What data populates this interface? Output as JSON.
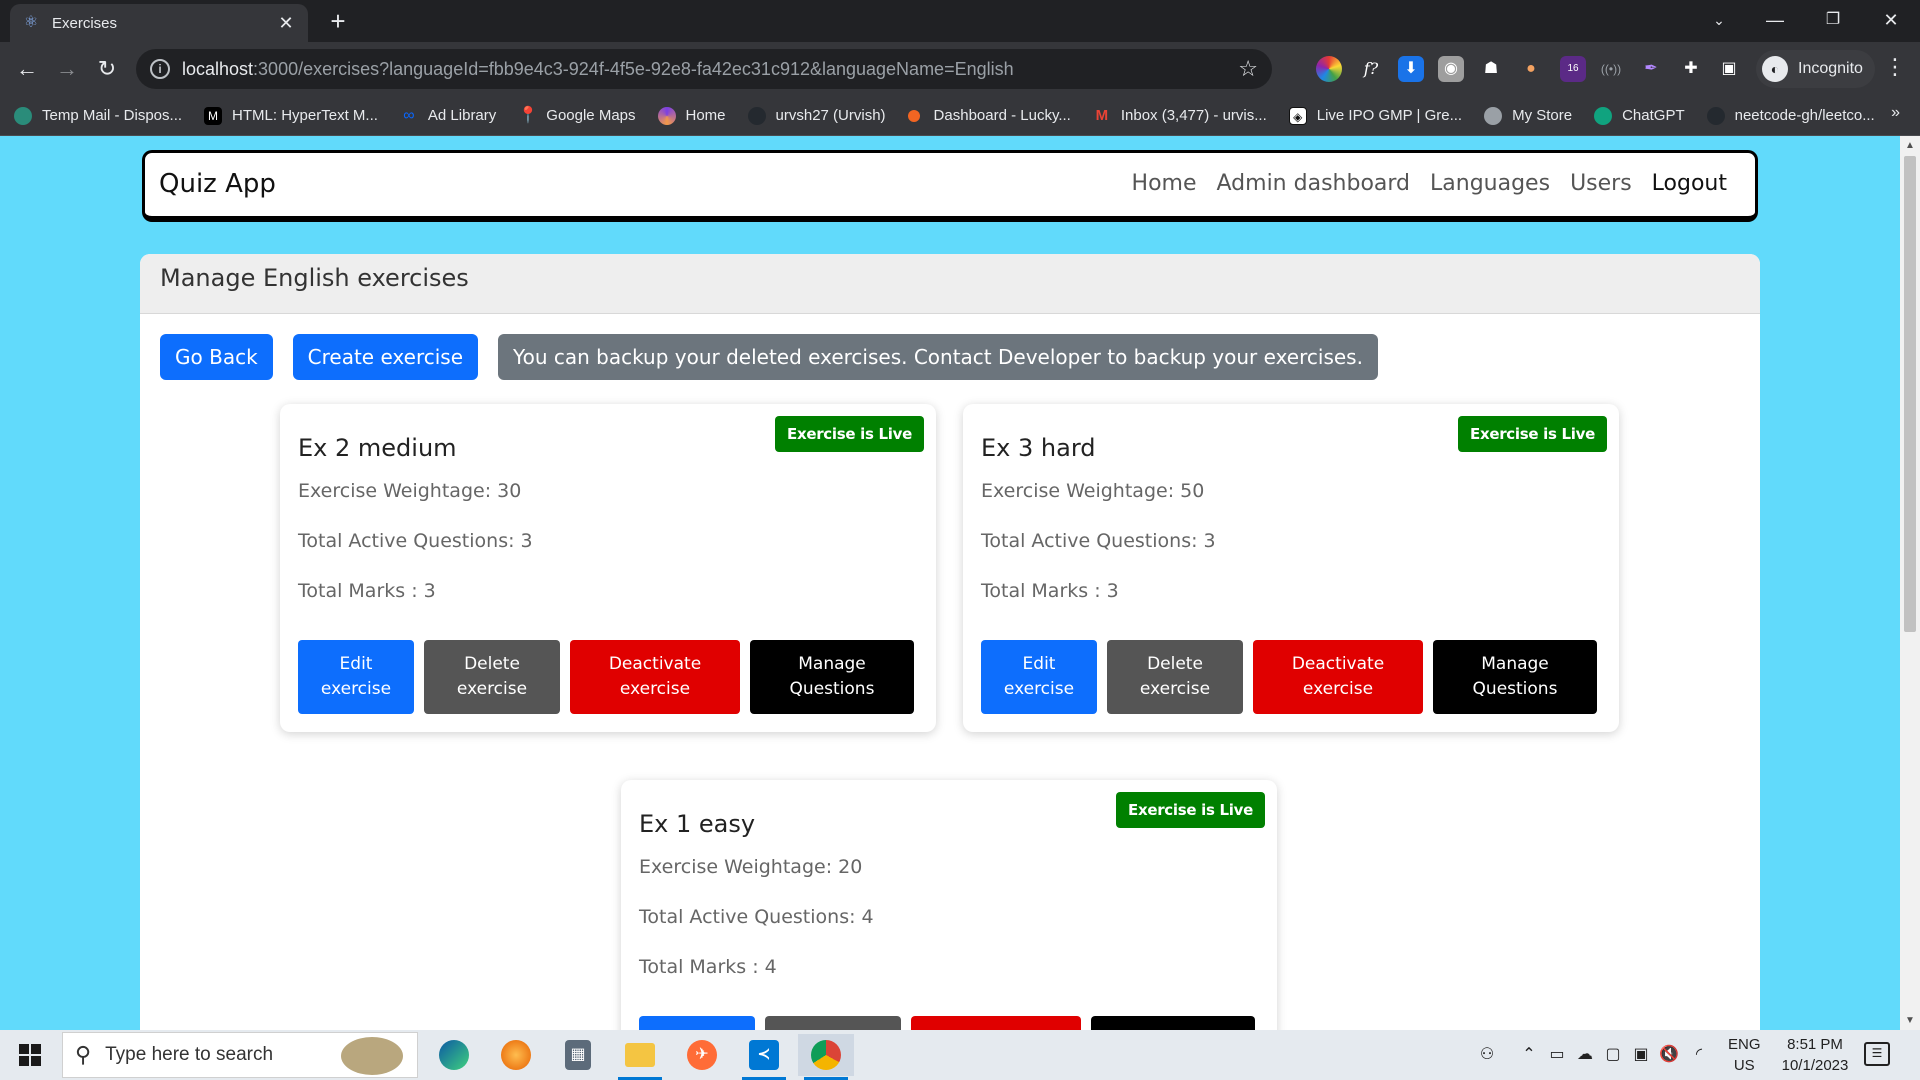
{
  "browser": {
    "tab_title": "Exercises",
    "url_host": "localhost",
    "url_rest": ":3000/exercises?languageId=fbb9e4c3-924f-4f5e-92e8-fa42ec31c912&languageName=English",
    "incognito_label": "Incognito",
    "extension_badge": "16",
    "bookmarks": [
      {
        "label": "Temp Mail - Dispos...",
        "color": "#2a8c7a"
      },
      {
        "label": "HTML: HyperText M...",
        "color": "#000000"
      },
      {
        "label": "Ad Library",
        "color": "#0866ff"
      },
      {
        "label": "Google Maps",
        "color": "#34a853"
      },
      {
        "label": "Home",
        "color": "#6b3fa0"
      },
      {
        "label": "urvsh27 (Urvish)",
        "color": "#24292f"
      },
      {
        "label": "Dashboard - Lucky...",
        "color": "#f26522"
      },
      {
        "label": "Inbox (3,477) - urvis...",
        "color": "#ea4335"
      },
      {
        "label": "Live IPO GMP | Gre...",
        "color": "#111111"
      },
      {
        "label": "My Store",
        "color": "#5f6368"
      },
      {
        "label": "ChatGPT",
        "color": "#10a37f"
      },
      {
        "label": "neetcode-gh/leetco...",
        "color": "#24292f"
      }
    ]
  },
  "app": {
    "brand": "Quiz App",
    "nav": {
      "home": "Home",
      "admin": "Admin dashboard",
      "languages": "Languages",
      "users": "Users",
      "logout": "Logout"
    },
    "header": "Manage English exercises",
    "go_back": "Go Back",
    "create": "Create exercise",
    "notice": "You can backup your deleted exercises. Contact Developer to backup your exercises.",
    "exercises": [
      {
        "badge": "Exercise is Live",
        "title": "Ex 2 medium",
        "weightage": "Exercise Weightage: 30",
        "questions": "Total Active Questions: 3",
        "marks": "Total Marks : 3"
      },
      {
        "badge": "Exercise is Live",
        "title": "Ex 3 hard",
        "weightage": "Exercise Weightage: 50",
        "questions": "Total Active Questions: 3",
        "marks": "Total Marks : 3"
      },
      {
        "badge": "Exercise is Live",
        "title": "Ex 1 easy",
        "weightage": "Exercise Weightage: 20",
        "questions": "Total Active Questions: 4",
        "marks": "Total Marks : 4"
      }
    ],
    "card_buttons": {
      "edit_1": "Edit",
      "edit_2": "exercise",
      "delete_1": "Delete",
      "delete_2": "exercise",
      "deactivate_1": "Deactivate",
      "deactivate_2": "exercise",
      "manage_1": "Manage",
      "manage_2": "Questions"
    }
  },
  "taskbar": {
    "search_placeholder": "Type here to search",
    "lang_1": "ENG",
    "lang_2": "US",
    "time": "8:51 PM",
    "date": "10/1/2023"
  }
}
